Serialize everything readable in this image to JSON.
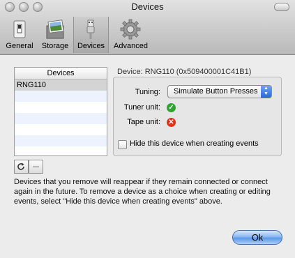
{
  "window": {
    "title": "Devices"
  },
  "toolbar": {
    "items": [
      {
        "label": "General",
        "icon": "general-switch-icon"
      },
      {
        "label": "Storage",
        "icon": "storage-photo-icon"
      },
      {
        "label": "Devices",
        "icon": "devices-usb-icon",
        "selected": true
      },
      {
        "label": "Advanced",
        "icon": "gear-icon"
      }
    ]
  },
  "device_list": {
    "header": "Devices",
    "rows": [
      "RNG110"
    ]
  },
  "details": {
    "device_label": "Device: RNG110 (0x509400001C41B1)",
    "tuning_label": "Tuning:",
    "tuning_value": "Simulate Button Presses",
    "tuner_label": "Tuner unit:",
    "tuner_status": "ok",
    "tape_label": "Tape unit:",
    "tape_status": "error",
    "hide_label": "Hide this device when creating events",
    "hide_checked": false
  },
  "note": "Devices that you remove will reappear if they remain connected or connect again in the future.  To remove a device as a choice when creating or editing events, select \"Hide this device when creating events\" above.",
  "ok_label": "Ok",
  "colors": {
    "ok_green": "#2fa52f",
    "error_red": "#e0301e",
    "accent_blue": "#2a67d7"
  }
}
